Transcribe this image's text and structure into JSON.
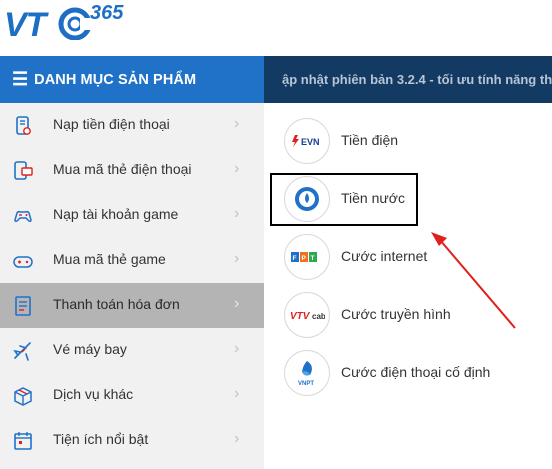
{
  "logo": {
    "text_vt": "VT",
    "text_365": "365",
    "brand_color": "#1e6fc4"
  },
  "header": {
    "menu_icon": "☰",
    "menu_title": "DANH MỤC SẢN PHẨM",
    "ticker": "ập nhật phiên bản 3.2.4 - tối ưu tính năng th"
  },
  "sidebar": {
    "items": [
      {
        "label": "Nạp tiền điện thoại",
        "icon": "phone-topup-icon"
      },
      {
        "label": "Mua mã thẻ điện thoại",
        "icon": "phone-card-icon"
      },
      {
        "label": "Nạp tài khoản game",
        "icon": "gamepad-icon"
      },
      {
        "label": "Mua mã thẻ game",
        "icon": "game-card-icon"
      },
      {
        "label": "Thanh toán hóa đơn",
        "icon": "bill-icon",
        "active": true
      },
      {
        "label": "Vé máy bay",
        "icon": "airplane-icon"
      },
      {
        "label": "Dịch vụ khác",
        "icon": "box-icon"
      },
      {
        "label": "Tiện ích nổi bật",
        "icon": "calendar-icon"
      }
    ],
    "chevron": "›"
  },
  "services": [
    {
      "label": "Tiền điện",
      "icon": "evn-logo-icon",
      "logo_text": "EVN"
    },
    {
      "label": "Tiền nước",
      "icon": "water-logo-icon"
    },
    {
      "label": "Cước internet",
      "icon": "fpt-logo-icon",
      "logo_text": "FPT"
    },
    {
      "label": "Cước truyền hình",
      "icon": "vtvcab-logo-icon",
      "logo_text": "VTVcab"
    },
    {
      "label": "Cước điện thoại cố định",
      "icon": "vnpt-logo-icon",
      "logo_text": "VNPT"
    }
  ],
  "colors": {
    "header_blue": "#1f72c8",
    "ticker_bg": "#123a63",
    "sidebar_bg": "#f1f1f1",
    "active_bg": "#b4b4b4",
    "annotation_red": "#e0201c"
  }
}
